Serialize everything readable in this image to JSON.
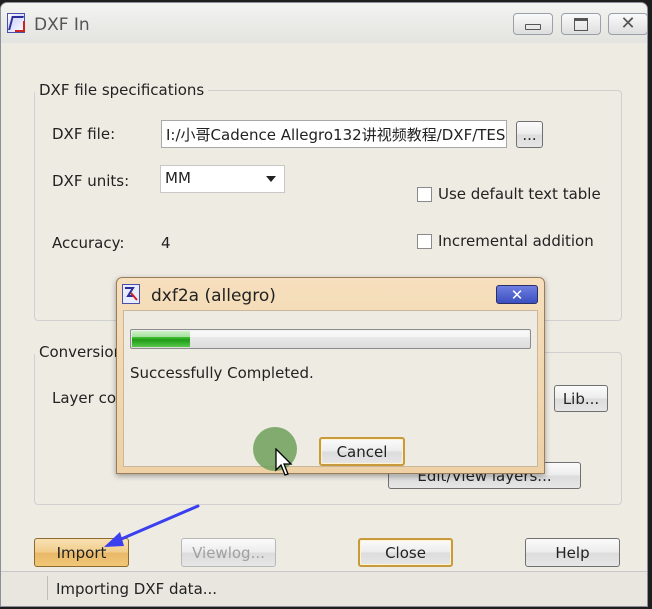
{
  "window": {
    "title": "DXF In",
    "buttons": {
      "minimize": "minimize",
      "maximize": "maximize",
      "close": "close"
    }
  },
  "specs": {
    "legend": "DXF file specifications",
    "file_label": "DXF file:",
    "file_value": "I:/小哥Cadence Allegro132讲视频教程/DXF/TES",
    "browse_label": "...",
    "units_label": "DXF units:",
    "units_value": "MM",
    "use_default_text_table": "Use default text table",
    "accuracy_label": "Accuracy:",
    "accuracy_value": "4",
    "incremental_addition": "Incremental addition"
  },
  "conversion": {
    "legend": "Conversion",
    "layer_label": "Layer cor",
    "lib_button": "Lib...",
    "edit_layers_button": "Edit/View layers..."
  },
  "footer": {
    "import": "Import",
    "viewlog": "Viewlog...",
    "close": "Close",
    "help": "Help"
  },
  "status": {
    "text": "Importing DXF data..."
  },
  "dialog": {
    "title": "dxf2a (allegro)",
    "close_glyph": "✕",
    "progress_percent": 15,
    "message": "Successfully Completed.",
    "cancel": "Cancel"
  },
  "colors": {
    "annotation_arrow": "#3a3ff0",
    "progress_green": "#37b72a",
    "focus_border": "#c99a3c"
  }
}
